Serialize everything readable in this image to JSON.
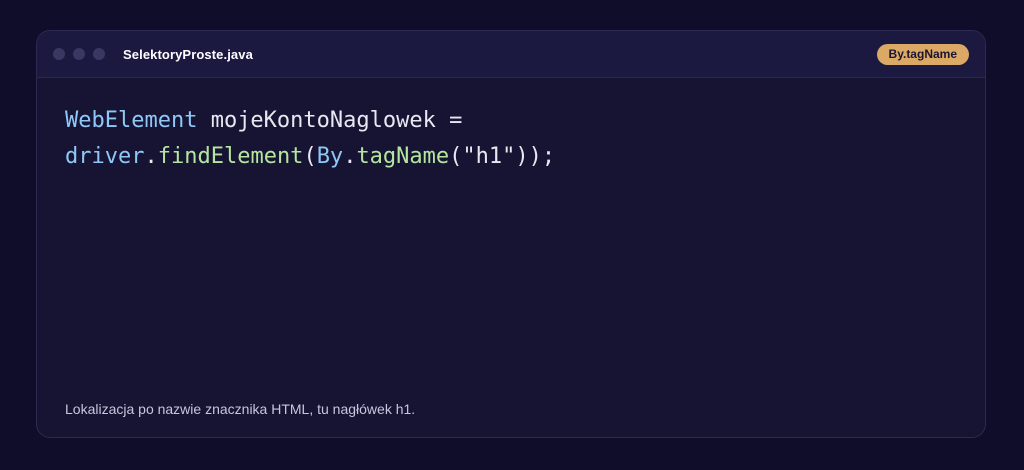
{
  "window": {
    "filename": "SelektoryProste.java",
    "badge": "By.tagName"
  },
  "code": {
    "line1": {
      "type": "WebElement",
      "rest": " mojeKontoNaglowek ="
    },
    "line2": {
      "obj": "driver",
      "dot1": ".",
      "method": "findElement",
      "paren_open": "(",
      "class": "By",
      "dot2": ".",
      "method2": "tagName",
      "args": "(\"h1\"));"
    }
  },
  "caption": "Lokalizacja po nazwie znacznika HTML, tu nagłówek h1.",
  "colors": {
    "background": "#0f0d29",
    "panel": "#161432",
    "titlebar": "#1b1940",
    "badge": "#dca865",
    "type_token": "#8fc8f8",
    "method_token": "#b4e6a0"
  }
}
